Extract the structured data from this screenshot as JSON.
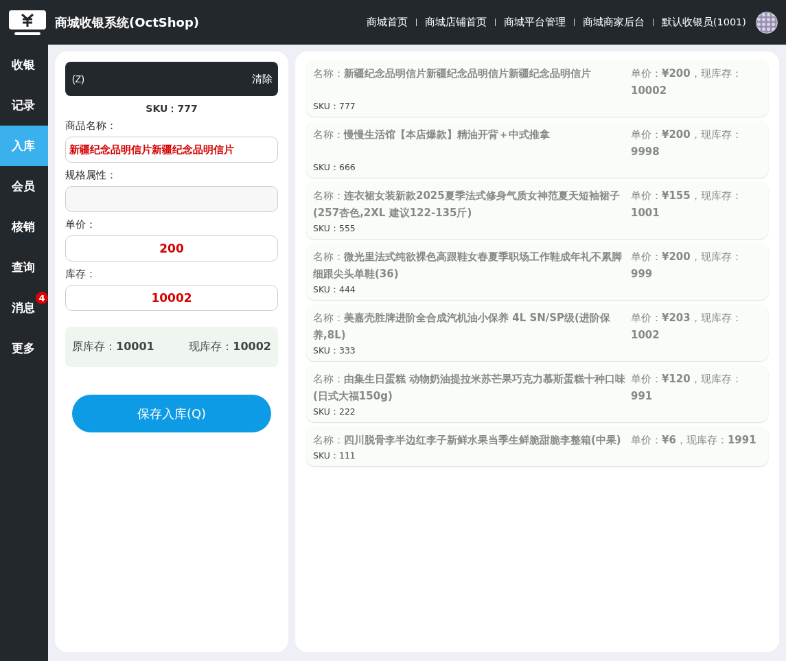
{
  "header": {
    "title": "商城收银系统(OctShop)",
    "nav": [
      "商城首页",
      "商城店铺首页",
      "商城平台管理",
      "商城商家后台",
      "默认收银员(1001)"
    ]
  },
  "sidebar": {
    "items": [
      {
        "label": "收银",
        "selected": false
      },
      {
        "label": "记录",
        "selected": false
      },
      {
        "label": "入库",
        "selected": true
      },
      {
        "label": "会员",
        "selected": false
      },
      {
        "label": "核销",
        "selected": false
      },
      {
        "label": "查询",
        "selected": false
      },
      {
        "label": "消息",
        "selected": false,
        "badge": "4"
      },
      {
        "label": "更多",
        "selected": false
      }
    ]
  },
  "form": {
    "search": {
      "placeholder": "(Z)",
      "clear": "清除"
    },
    "sku": "SKU：777",
    "fields": [
      {
        "label": "商品名称：",
        "value": "新疆纪念品明信片新疆纪念品明信片",
        "kind": "name"
      },
      {
        "label": "规格属性：",
        "kind": "spec"
      },
      {
        "label": "单价：",
        "value": "200",
        "kind": "number"
      },
      {
        "label": "库存：",
        "value": "10002",
        "kind": "number"
      }
    ],
    "summary": [
      "原库存：**10001**",
      "现库存：**10002**"
    ],
    "save": "保存入库(Q)"
  },
  "products": [
    {
      "name": "名称：**新疆纪念品明信片新疆纪念品明信片新疆纪念品明信片**",
      "price": "单价：**¥200**，现库存：**10002**",
      "sku": "SKU：777"
    },
    {
      "name": "名称：**慢慢生活馆【本店爆款】精油开背＋中式推拿**",
      "price": "单价：**¥200**，现库存：**9998**",
      "sku": "SKU：666"
    },
    {
      "name": "名称：**连衣裙女装新款2025夏季法式修身气质女神范夏天短袖裙子(257杏色,2XL 建议122-135斤)**",
      "price": "单价：**¥155**，现库存：**1001**",
      "sku": "SKU：555"
    },
    {
      "name": "名称：**微光里法式纯欲裸色高跟鞋女春夏季职场工作鞋成年礼不累脚细跟尖头单鞋(36)**",
      "price": "单价：**¥200**，现库存：**999**",
      "sku": "SKU：444"
    },
    {
      "name": "名称：**美嘉壳胜牌进阶全合成汽机油小保养 4L SN/SP级(进阶保养,8L)**",
      "price": "单价：**¥203**，现库存：**1002**",
      "sku": "SKU：333"
    },
    {
      "name": "名称：**由集生日蛋糕 动物奶油提拉米苏芒果巧克力慕斯蛋糕十种口味(日式大福150g)**",
      "price": "单价：**¥120**，现库存：**991**",
      "sku": "SKU：222"
    },
    {
      "name": "名称：**四川脱骨李半边红李子新鲜水果当季生鲜脆甜脆李整箱(中果)**",
      "price": "单价：**¥6**，现库存：**1991**",
      "sku": "SKU：111"
    }
  ]
}
